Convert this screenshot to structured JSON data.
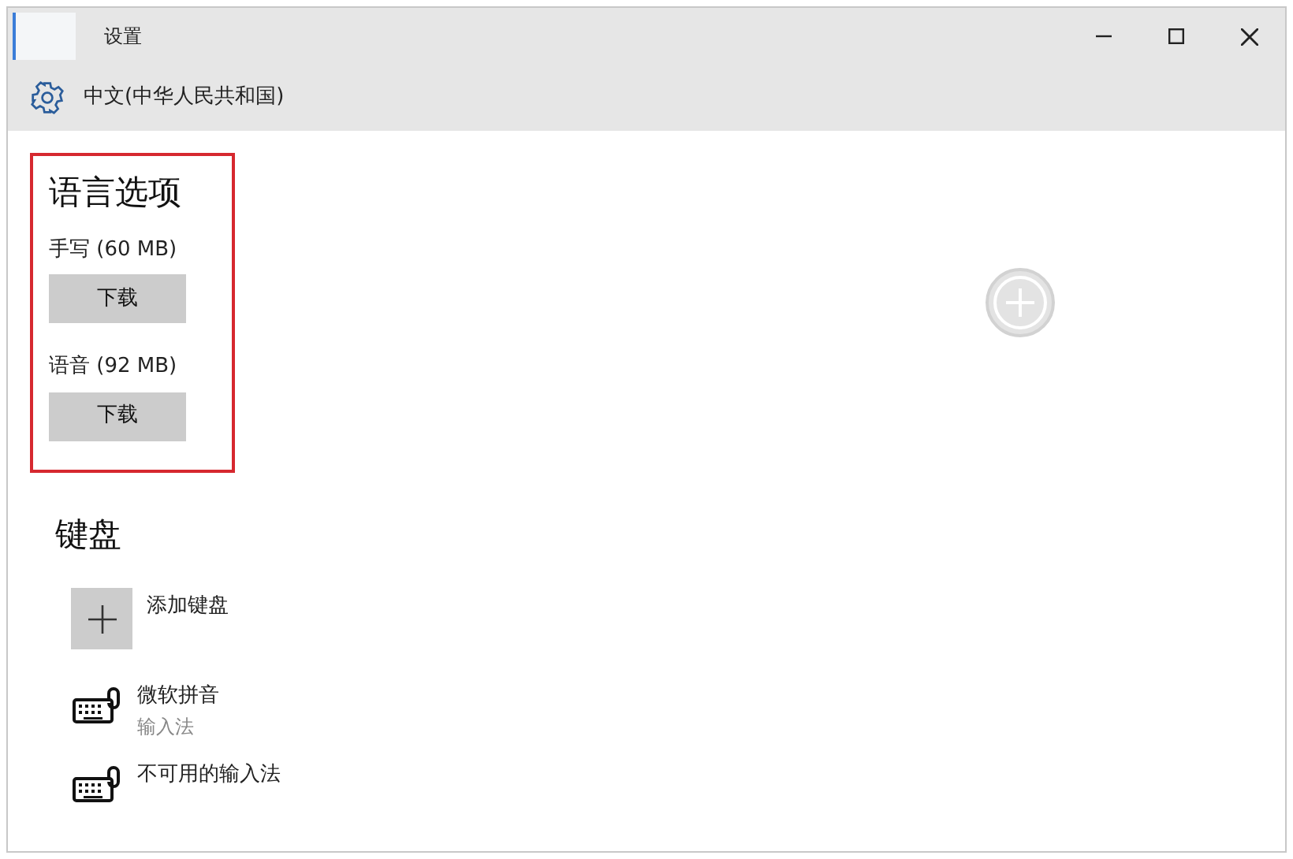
{
  "window": {
    "title": "设置"
  },
  "header": {
    "title": "中文(中华人民共和国)"
  },
  "language_options": {
    "heading": "语言选项",
    "items": [
      {
        "label": "手写 (60 MB)",
        "button": "下载"
      },
      {
        "label": "语音 (92 MB)",
        "button": "下载"
      }
    ]
  },
  "keyboards": {
    "heading": "键盘",
    "add": {
      "label": "添加键盘"
    },
    "items": [
      {
        "name": "微软拼音",
        "subtitle": "输入法"
      },
      {
        "name": "不可用的输入法"
      }
    ]
  }
}
